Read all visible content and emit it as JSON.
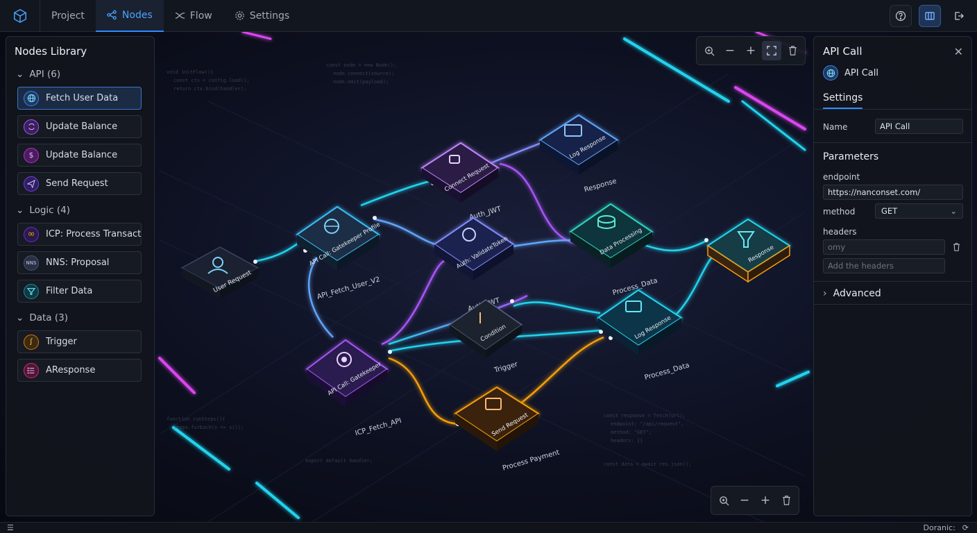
{
  "topbar": {
    "tabs": [
      {
        "label": "Project",
        "icon": "none"
      },
      {
        "label": "Nodes",
        "icon": "nodes-icon",
        "active": true
      },
      {
        "label": "Flow",
        "icon": "flow-icon"
      },
      {
        "label": "Settings",
        "icon": "gear-icon"
      }
    ]
  },
  "left_panel": {
    "title": "Nodes Library",
    "groups": [
      {
        "label": "API (6)",
        "items": [
          "Fetch User Data",
          "Update Balance",
          "Update Balance",
          "Send Request"
        ]
      },
      {
        "label": "Logic (4)",
        "items": [
          "ICP: Process Transaction",
          "NNS: Proposal",
          "Filter Data"
        ]
      },
      {
        "label": "Data (3)",
        "items": [
          "Trigger",
          "AResponse"
        ]
      }
    ],
    "nns_badge": "NNS"
  },
  "right_panel": {
    "title": "API Call",
    "subtitle": "API Call",
    "tab": "Settings",
    "name_label": "Name",
    "name_value": "API Call",
    "parameters_title": "Parameters",
    "endpoint_label": "endpoint",
    "endpoint_value": "https://nanconset.com/",
    "method_label": "method",
    "method_value": "GET",
    "headers_label": "headers",
    "headers_placeholder": "omy",
    "add_headers_placeholder": "Add the headers",
    "advanced_label": "Advanced"
  },
  "graph": {
    "nodes": [
      {
        "title": "User Request",
        "caption": ""
      },
      {
        "title": "API Call: Gatekeeper Profile",
        "caption": "API_Fetch_User_V2"
      },
      {
        "title": "Connect Request",
        "caption": "Auth_JWT"
      },
      {
        "title": "Log Response",
        "caption": "Response"
      },
      {
        "title": "Auth: ValidateToken",
        "caption": "Auth_JWT"
      },
      {
        "title": "Data Processing",
        "caption": "Process_Data"
      },
      {
        "title": "Response",
        "caption": ""
      },
      {
        "title": "Condition",
        "caption": "Trigger"
      },
      {
        "title": "Log Response",
        "caption": "Process_Data"
      },
      {
        "title": "API Call: Gatekeeper",
        "caption": "ICP_Fetch_API"
      },
      {
        "title": "Send Request",
        "caption": "Process Payment"
      }
    ]
  },
  "statusbar": {
    "right_text": "Doranic:"
  },
  "colors": {
    "accent": "#2f8cff",
    "cyan": "#22d3ee",
    "purple": "#a855f7",
    "orange": "#f59e0b"
  }
}
